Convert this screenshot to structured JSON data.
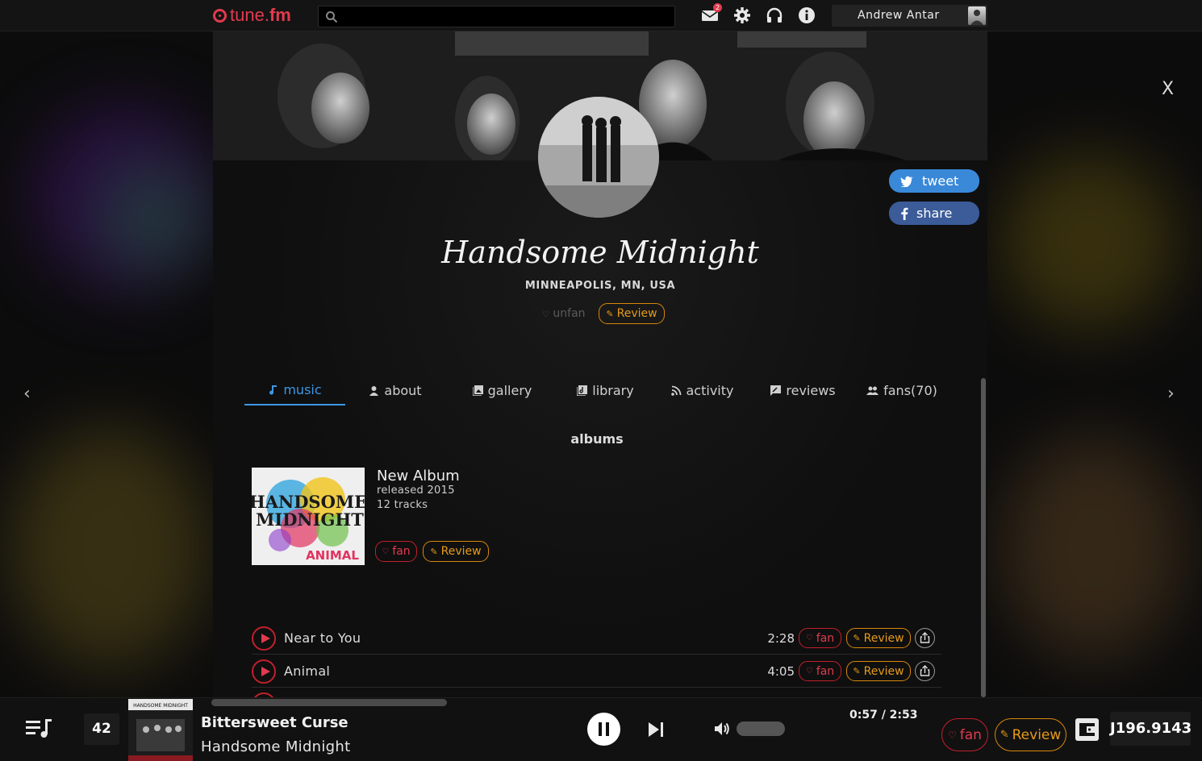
{
  "topbar": {
    "logo_prefix": "tune.",
    "logo_suffix": "fm",
    "search_placeholder": "",
    "mail_badge": "2",
    "user_name": "Andrew Antar"
  },
  "artist": {
    "name": "Handsome Midnight",
    "location": "MINNEAPOLIS, MN, USA",
    "unfan_label": "unfan",
    "review_label": "Review",
    "tweet_label": "tweet",
    "share_label": "share"
  },
  "tabs": [
    {
      "label": "music",
      "icon": "music-note-icon",
      "active": true
    },
    {
      "label": "about",
      "icon": "person-icon",
      "active": false
    },
    {
      "label": "gallery",
      "icon": "image-icon",
      "active": false
    },
    {
      "label": "library",
      "icon": "library-icon",
      "active": false
    },
    {
      "label": "activity",
      "icon": "rss-icon",
      "active": false
    },
    {
      "label": "reviews",
      "icon": "comment-icon",
      "active": false
    },
    {
      "label": "fans(70)",
      "icon": "people-icon",
      "active": false
    }
  ],
  "albums": {
    "section_title": "albums",
    "items": [
      {
        "title": "New Album",
        "released": "released 2015",
        "tracks_count": "12 tracks",
        "art_text_1": "HANDSOME",
        "art_text_2": "MIDNIGHT",
        "art_text_3": "ANIMAL",
        "fan_label": "fan",
        "review_label": "Review"
      }
    ]
  },
  "tracks": [
    {
      "name": "Near to You",
      "duration": "2:28",
      "fan_label": "fan",
      "review_label": "Review"
    },
    {
      "name": "Animal",
      "duration": "4:05",
      "fan_label": "fan",
      "review_label": "Review"
    }
  ],
  "player": {
    "queue_count": "42",
    "art_caption": "HANDSOME MIDNIGHT",
    "title": "Bittersweet Curse",
    "artist": "Handsome Midnight",
    "time": "0:57 / 2:53",
    "progress": 0.33,
    "fan_label": "fan",
    "review_label": "Review",
    "balance": "J196.9143"
  },
  "colors": {
    "accent_red": "#e23a4e",
    "accent_orange": "#e59a1a",
    "accent_blue": "#3d97e6",
    "twitter": "#3a89d9",
    "facebook": "#3b5b99"
  },
  "controls": {
    "close_label": "X",
    "prev_arrow": "‹",
    "next_arrow": "›"
  }
}
